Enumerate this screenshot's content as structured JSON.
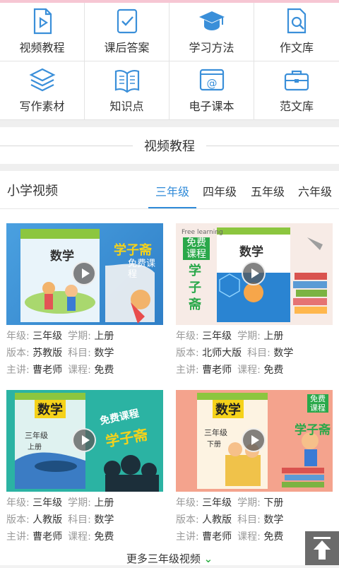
{
  "nav_grid": [
    {
      "label": "视频教程",
      "icon": "video-doc-icon"
    },
    {
      "label": "课后答案",
      "icon": "checked-doc-icon"
    },
    {
      "label": "学习方法",
      "icon": "graduation-cap-icon"
    },
    {
      "label": "作文库",
      "icon": "doc-search-icon"
    },
    {
      "label": "写作素材",
      "icon": "layers-icon"
    },
    {
      "label": "知识点",
      "icon": "open-book-icon"
    },
    {
      "label": "电子课本",
      "icon": "at-window-icon"
    },
    {
      "label": "范文库",
      "icon": "briefcase-icon"
    }
  ],
  "section_title": "视频教程",
  "category": {
    "heading": "小学视频",
    "tabs": [
      "三年级",
      "四年级",
      "五年级",
      "六年级"
    ],
    "active_tab": "三年级"
  },
  "labels": {
    "grade": "年级:",
    "term": "学期:",
    "edition": "版本:",
    "subject": "科目:",
    "teacher": "主讲:",
    "course": "课程:"
  },
  "videos": [
    {
      "book": "数学",
      "promo_title": "学子斋",
      "promo_sub": "免费课程",
      "grade": "三年级",
      "term": "上册",
      "edition": "苏教版",
      "subject": "数学",
      "teacher": "曹老师",
      "course": "免费"
    },
    {
      "book": "数学",
      "promo_title": "学子斋",
      "promo_sub": "免费课程",
      "promo_en": "Free learning",
      "grade": "三年级",
      "term": "上册",
      "edition": "北师大版",
      "subject": "数学",
      "teacher": "曹老师",
      "course": "免费"
    },
    {
      "book": "数学",
      "book_grade": "三年级",
      "book_term": "上册",
      "promo_title": "学子斋",
      "promo_sub": "免费课程",
      "grade": "三年级",
      "term": "上册",
      "edition": "人教版",
      "subject": "数学",
      "teacher": "曹老师",
      "course": "免费"
    },
    {
      "book": "数学",
      "book_grade": "三年级",
      "book_term": "下册",
      "promo_title": "学子斋",
      "promo_sub": "免费课程",
      "grade": "三年级",
      "term": "下册",
      "edition": "人教版",
      "subject": "数学",
      "teacher": "曹老师",
      "course": "免费"
    }
  ],
  "more_link": "更多三年级视频",
  "colors": {
    "accent": "#2f8ad8",
    "icon": "#3a8fd9",
    "promo_green": "#2aa84a",
    "promo_yellow": "#f5d21a"
  }
}
